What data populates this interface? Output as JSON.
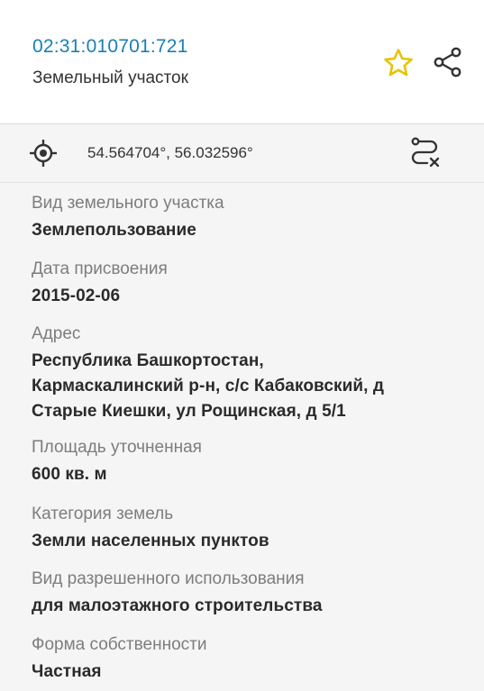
{
  "header": {
    "cadastral_number": "02:31:010701:721",
    "object_type": "Земельный участок",
    "favorite_icon": "star-outline-icon",
    "share_icon": "share-icon",
    "accent_color": "#1a7fb3",
    "star_color": "#e6c400"
  },
  "coordinates": {
    "locate_icon": "crosshair-icon",
    "text": "54.564704°, 56.032596°",
    "route_icon": "route-clear-icon"
  },
  "fields": [
    {
      "label": "Вид земельного участка",
      "value": "Землепользование"
    },
    {
      "label": "Дата присвоения",
      "value": "2015-02-06"
    },
    {
      "label": "Адрес",
      "value_lines": [
        "Республика Башкортостан,",
        "Кармаскалинский р-н, с/с Кабаковский, д",
        "Старые Киешки, ул Рощинская, д 5/1"
      ]
    },
    {
      "label": "Площадь уточненная",
      "value": "600 кв. м"
    },
    {
      "label": "Категория земель",
      "value": "Земли населенных пунктов"
    },
    {
      "label": "Вид разрешенного использования",
      "value": "для малоэтажного строительства"
    },
    {
      "label": "Форма собственности",
      "value": "Частная"
    }
  ]
}
